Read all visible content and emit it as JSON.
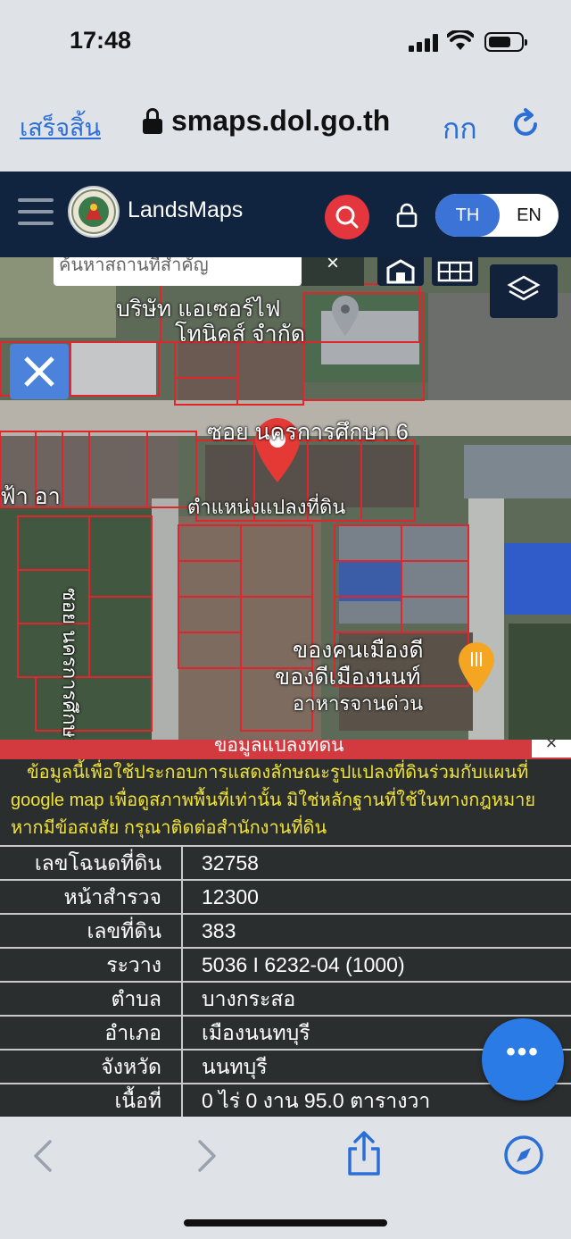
{
  "status": {
    "time": "17:48"
  },
  "browser": {
    "done_label": "เสร็จสิ้น",
    "url": "smaps.dol.go.th",
    "text_size_label": "กก",
    "reload_icon": "reload-icon"
  },
  "app": {
    "brand": "LandsMaps",
    "lang_th": "TH",
    "lang_en": "EN",
    "colors": {
      "header_bg": "#102440",
      "search_button": "#e3363d",
      "accent": "#3b73d6",
      "parcel_line": "#e0262c"
    }
  },
  "map": {
    "search_placeholder": "ค้นหาสถานที่สำคัญ",
    "search_clear": "×",
    "labels": {
      "company": "บริษัท แอเซอร์ไฟ",
      "company2": "โทนิคส์ จำกัด",
      "soi_main": "ซอย นครการศึกษา 6",
      "parcel_position": "ตำแหน่งแปลงที่ดิน",
      "soi_side": "ซอย นครการศึกษา",
      "shop_1": "ของคนเมืองดี",
      "shop_2": "ของดีเมืองนนท์",
      "shop_3": "อาหารจานด่วน",
      "left_fragment": "ฟ้า อา"
    }
  },
  "info": {
    "title": "ข้อมูลแปลงที่ดิน",
    "close": "×",
    "notice_line1": "ข้อมูลนี้เพื่อใช้ประกอบการแสดงลักษณะรูปแปลงที่ดินร่วมกับแผนที่",
    "notice_line2": "google map เพื่อดูสภาพพื้นที่เท่านั้น มิใช่หลักฐานที่ใช้ในทางกฎหมาย",
    "notice_line3": "หากมีข้อสงสัย กรุณาติดต่อสำนักงานที่ดิน",
    "rows": [
      {
        "key": "เลขโฉนดที่ดิน",
        "value": "32758"
      },
      {
        "key": "หน้าสำรวจ",
        "value": "12300"
      },
      {
        "key": "เลขที่ดิน",
        "value": "383"
      },
      {
        "key": "ระวาง",
        "value": "5036 I 6232-04 (1000)"
      },
      {
        "key": "ตำบล",
        "value": "บางกระสอ"
      },
      {
        "key": "อำเภอ",
        "value": "เมืองนนทบุรี"
      },
      {
        "key": "จังหวัด",
        "value": "นนทบุรี"
      },
      {
        "key": "เนื้อที่",
        "value": "0 ไร่ 0 งาน 95.0 ตารางวา"
      }
    ],
    "fab_label": "•••"
  }
}
